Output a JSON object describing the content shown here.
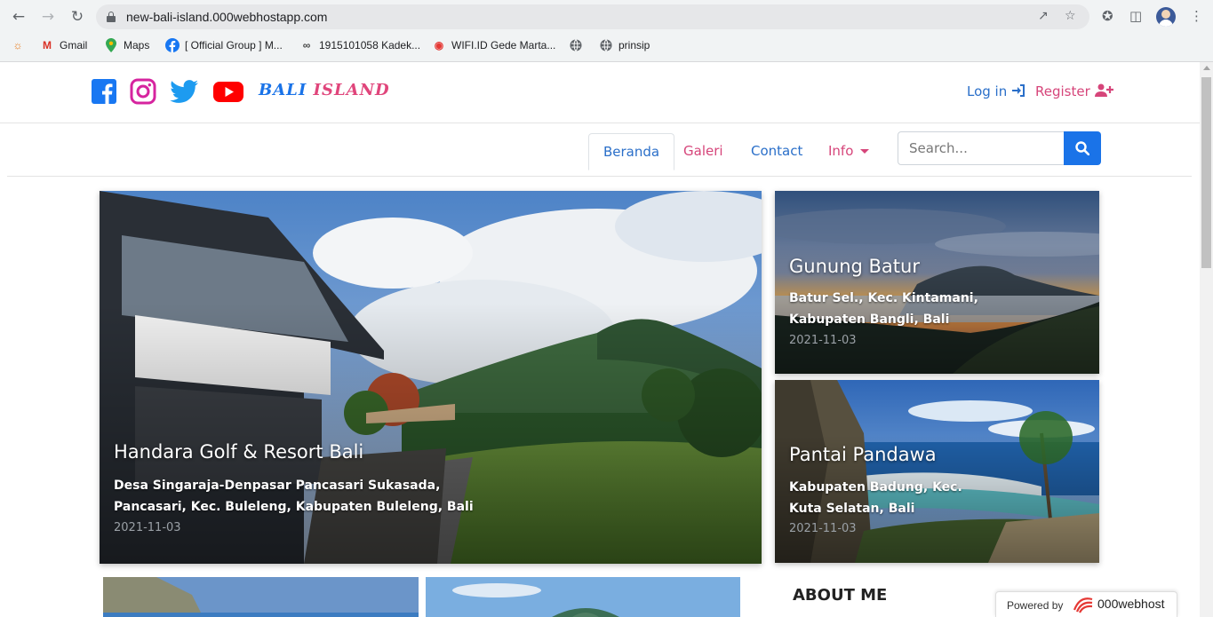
{
  "browser": {
    "url": "new-bali-island.000webhostapp.com",
    "bookmarks": [
      {
        "label": "",
        "icon": "eye-icon"
      },
      {
        "label": "Gmail",
        "icon": "gmail-icon"
      },
      {
        "label": "Maps",
        "icon": "maps-icon"
      },
      {
        "label": "[ Official Group ] M...",
        "icon": "facebook-icon"
      },
      {
        "label": "1915101058 Kadek...",
        "icon": "link-icon"
      },
      {
        "label": "WIFI.ID Gede Marta...",
        "icon": "wifi-icon"
      },
      {
        "label": "",
        "icon": "globe-icon"
      },
      {
        "label": "prinsip",
        "icon": "globe-icon"
      }
    ]
  },
  "header": {
    "brand_part1": "BALI",
    "brand_part2": "ISLAND",
    "login_label": "Log in",
    "register_label": "Register",
    "social": [
      "facebook-icon",
      "instagram-icon",
      "twitter-icon",
      "youtube-icon"
    ]
  },
  "nav": {
    "tabs": [
      {
        "label": "Beranda",
        "active": true
      },
      {
        "label": "Galeri"
      },
      {
        "label": "Contact"
      },
      {
        "label": "Info"
      }
    ],
    "search_placeholder": "Search..."
  },
  "featured": [
    {
      "title": "Handara Golf & Resort Bali",
      "desc_line1": "Desa Singaraja-Denpasar Pancasari Sukasada,",
      "desc_line2": "Pancasari, Kec. Buleleng, Kabupaten Buleleng, Bali",
      "date": "2021-11-03"
    },
    {
      "title": "Gunung Batur",
      "desc_line1": "Batur Sel., Kec. Kintamani,",
      "desc_line2": "Kabupaten Bangli, Bali",
      "date": "2021-11-03"
    },
    {
      "title": "Pantai Pandawa",
      "desc_line1": "Kabupaten Badung, Kec.",
      "desc_line2": "Kuta Selatan, Bali",
      "date": "2021-11-03"
    }
  ],
  "sidebar": {
    "about_title": "ABOUT ME"
  },
  "footer_badge": {
    "label": "Powered by",
    "name": "000webhost"
  },
  "colors": {
    "blue": "#1a73e8",
    "pink": "#e0457b"
  }
}
